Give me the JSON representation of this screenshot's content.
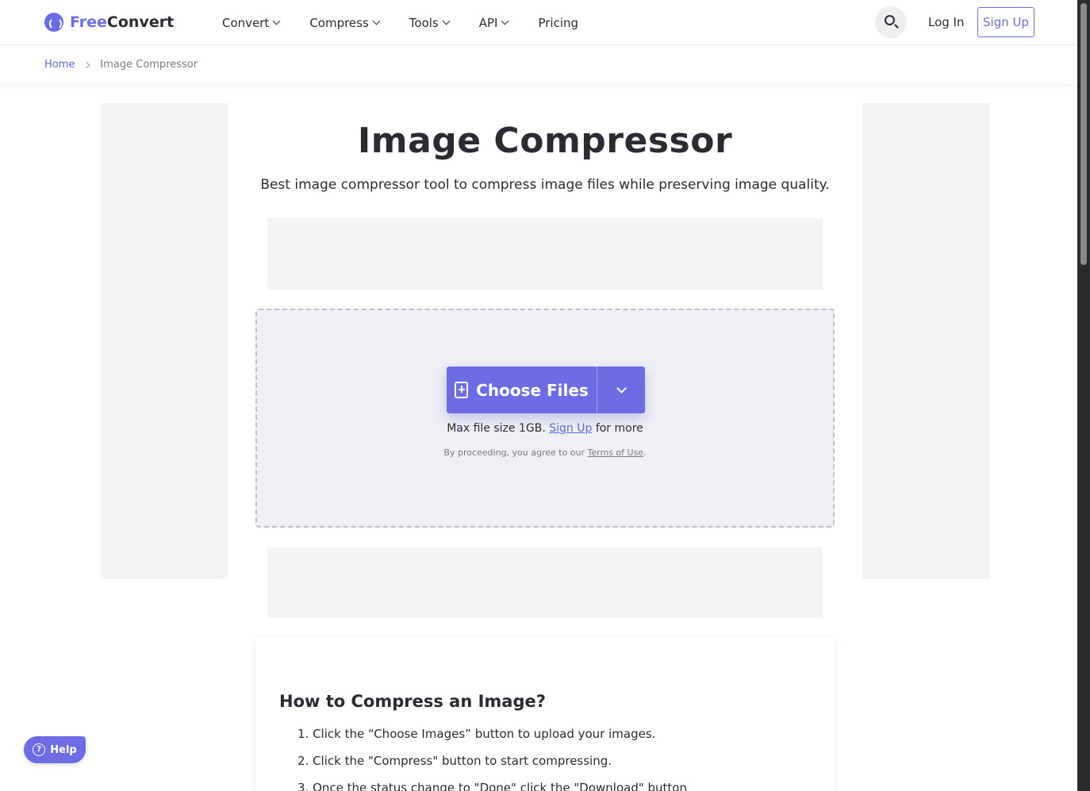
{
  "brand": {
    "free": "Free",
    "convert": "Convert"
  },
  "nav": {
    "items": [
      {
        "label": "Convert",
        "dropdown": true
      },
      {
        "label": "Compress",
        "dropdown": true
      },
      {
        "label": "Tools",
        "dropdown": true
      },
      {
        "label": "API",
        "dropdown": true
      },
      {
        "label": "Pricing",
        "dropdown": false
      }
    ],
    "login": "Log In",
    "signup": "Sign Up"
  },
  "breadcrumb": {
    "home": "Home",
    "current": "Image Compressor"
  },
  "main": {
    "title": "Image Compressor",
    "subtitle": "Best image compressor tool to compress image files while preserving image quality."
  },
  "upload": {
    "choose_label": "Choose Files",
    "max_prefix": "Max file size 1GB.",
    "signup_link": "Sign Up",
    "max_suffix": "for more",
    "terms_prefix": "By proceeding, you agree to our",
    "terms_link": "Terms of Use",
    "terms_suffix": "."
  },
  "howto": {
    "title": "How to Compress an Image?",
    "steps": [
      "1. Click the “Choose Images” button to upload your images.",
      "2. Click the \"Compress\" button to start compressing.",
      "3. Once the status change to \"Done\" click the \"Download\" button"
    ]
  },
  "help": {
    "label": "Help"
  },
  "colors": {
    "accent": "#6c6ce5",
    "link": "#5a6ad6",
    "dropzone_bg": "#efeff4"
  }
}
